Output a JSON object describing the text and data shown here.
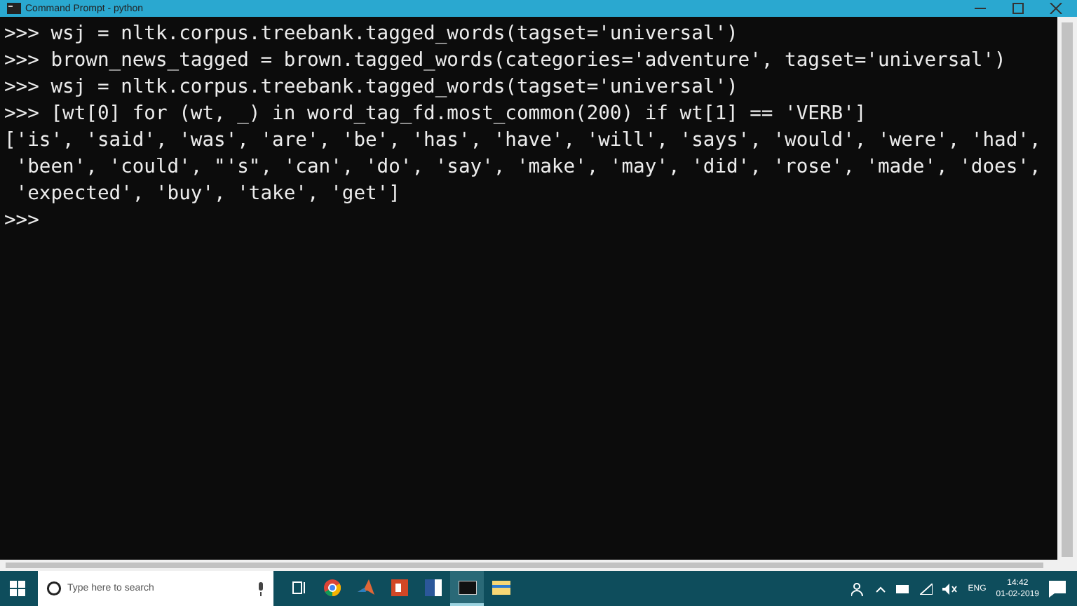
{
  "window": {
    "title": "Command Prompt - python"
  },
  "console": {
    "lines": [
      ">>> wsj = nltk.corpus.treebank.tagged_words(tagset='universal')",
      ">>> brown_news_tagged = brown.tagged_words(categories='adventure', tagset='universal')",
      ">>> wsj = nltk.corpus.treebank.tagged_words(tagset='universal')",
      ">>> [wt[0] for (wt, _) in word_tag_fd.most_common(200) if wt[1] == 'VERB']",
      "['is', 'said', 'was', 'are', 'be', 'has', 'have', 'will', 'says', 'would', 'were', 'had',",
      " 'been', 'could', \"'s\", 'can', 'do', 'say', 'make', 'may', 'did', 'rose', 'made', 'does',",
      " 'expected', 'buy', 'take', 'get']",
      ">>>"
    ]
  },
  "taskbar": {
    "search": {
      "placeholder": "Type here to search"
    },
    "apps": [
      {
        "kind": "taskview",
        "selected": false
      },
      {
        "kind": "chrome",
        "selected": false
      },
      {
        "kind": "matlab",
        "selected": false
      },
      {
        "kind": "powerpoint",
        "selected": false
      },
      {
        "kind": "word",
        "selected": false
      },
      {
        "kind": "terminal",
        "selected": true
      },
      {
        "kind": "folder",
        "selected": false
      }
    ],
    "language": "ENG",
    "time": "14:42",
    "date": "01-02-2019"
  }
}
